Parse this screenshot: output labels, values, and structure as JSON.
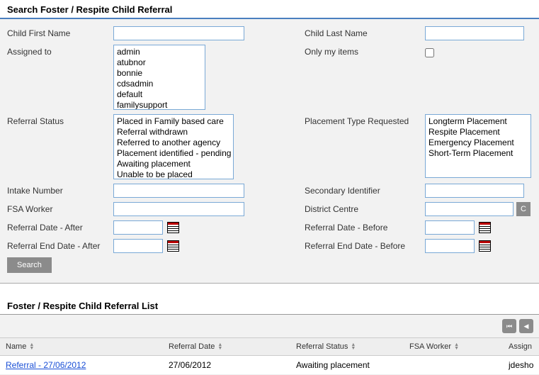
{
  "section_title": "Search Foster / Respite Child Referral",
  "labels": {
    "child_first_name": "Child First Name",
    "child_last_name": "Child Last Name",
    "assigned_to": "Assigned to",
    "only_my_items": "Only my items",
    "referral_status": "Referral Status",
    "placement_type_requested": "Placement Type Requested",
    "intake_number": "Intake Number",
    "secondary_identifier": "Secondary Identifier",
    "fsa_worker": "FSA Worker",
    "district_centre": "District Centre",
    "referral_date_after": "Referral Date - After",
    "referral_date_before": "Referral Date - Before",
    "referral_end_after": "Referral End Date - After",
    "referral_end_before": "Referral End Date - Before"
  },
  "assigned_to_items": [
    "admin",
    "atubnor",
    "bonnie",
    "cdsadmin",
    "default",
    "familysupport"
  ],
  "referral_status_items": [
    "Placed in Family based care",
    "Referral withdrawn",
    "Referred to another agency",
    "Placement identified - pending",
    "Awaiting placement",
    "Unable to be placed"
  ],
  "placement_type_items": [
    "Longterm Placement",
    "Respite Placement",
    "Emergency Placement",
    "Short-Term Placement"
  ],
  "buttons": {
    "search": "Search",
    "choose_district": "C"
  },
  "list_section_title": "Foster / Respite Child Referral List",
  "columns": {
    "name": "Name",
    "referral_date": "Referral Date",
    "referral_status": "Referral Status",
    "fsa_worker": "FSA Worker",
    "assigned": "Assign"
  },
  "rows": [
    {
      "name": "Referral - 27/06/2012",
      "referral_date": "27/06/2012",
      "referral_status": "Awaiting placement",
      "fsa_worker": "",
      "assigned": "jdesho"
    }
  ]
}
